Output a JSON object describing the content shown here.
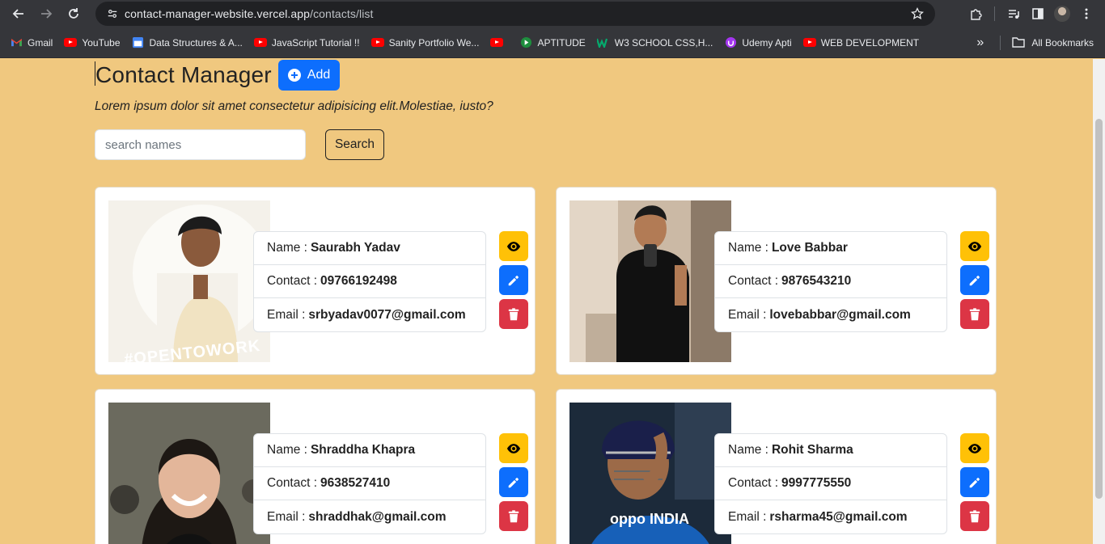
{
  "browser": {
    "url_host": "contact-manager-website.vercel.app",
    "url_path": "/contacts/list",
    "bookmarks": [
      {
        "label": "Gmail",
        "icon": "gmail-icon"
      },
      {
        "label": "YouTube",
        "icon": "youtube-icon"
      },
      {
        "label": "Data Structures & A...",
        "icon": "calendar-icon"
      },
      {
        "label": "JavaScript Tutorial  !!",
        "icon": "youtube-icon"
      },
      {
        "label": "Sanity Portfolio We...",
        "icon": "youtube-icon"
      },
      {
        "label": "",
        "icon": "youtube-icon"
      },
      {
        "label": "APTITUDE",
        "icon": "play-store-icon"
      },
      {
        "label": "W3 SCHOOL CSS,H...",
        "icon": "w3-icon"
      },
      {
        "label": "Udemy Apti",
        "icon": "udemy-icon"
      },
      {
        "label": "WEB DEVELOPMENT",
        "icon": "youtube-icon"
      }
    ],
    "all_bookmarks": "All Bookmarks"
  },
  "header": {
    "title": "Contact Manager",
    "add_label": "Add",
    "subtitle": "Lorem ipsum dolor sit amet consectetur adipisicing elit.Molestiae, iusto?"
  },
  "search": {
    "placeholder": "search names",
    "button_label": "Search"
  },
  "labels": {
    "name": "Name :",
    "contact": "Contact :",
    "email": "Email :"
  },
  "contacts": [
    {
      "name": "Saurabh Yadav",
      "contact": "09766192498",
      "email": "srbyadav0077@gmail.com",
      "photo_badge": "#OPENTOWORK"
    },
    {
      "name": "Love Babbar",
      "contact": "9876543210",
      "email": "lovebabbar@gmail.com"
    },
    {
      "name": "Shraddha Khapra",
      "contact": "9638527410",
      "email": "shraddhak@gmail.com"
    },
    {
      "name": "Rohit Sharma",
      "contact": "9997775550",
      "email": "rsharma45@gmail.com",
      "photo_jersey": "oppo INDIA"
    }
  ],
  "colors": {
    "page_bg": "#f0c87f",
    "primary": "#0d6efd",
    "warning": "#ffc107",
    "danger": "#dc3545"
  }
}
